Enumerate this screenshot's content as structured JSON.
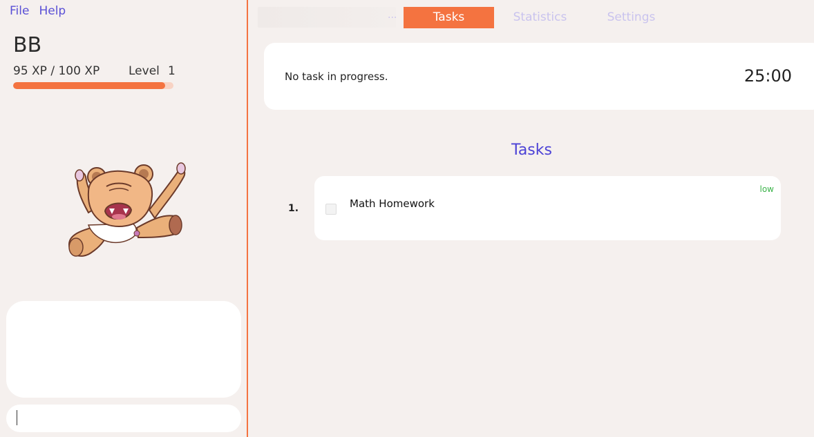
{
  "menu": {
    "file": "File",
    "help": "Help"
  },
  "pet": {
    "name": "BB",
    "xp_text": "95 XP / 100 XP",
    "level_label": "Level",
    "level_value": "1",
    "xp_progress": 0.95
  },
  "chat": {
    "input_value": ""
  },
  "tabs": {
    "hidden": "...",
    "tasks": "Tasks",
    "statistics": "Statistics",
    "settings": "Settings"
  },
  "timer": {
    "status": "No task in progress.",
    "time": "25:00"
  },
  "tasks": {
    "heading": "Tasks",
    "items": [
      {
        "index": "1.",
        "title": "Math Homework",
        "priority": "low",
        "done": false
      }
    ]
  },
  "colors": {
    "accent": "#f47340",
    "link": "#5a50d6",
    "heading": "#4c42d6",
    "inactive_tab": "#c9c3ee",
    "priority_low": "#3bb34a"
  }
}
